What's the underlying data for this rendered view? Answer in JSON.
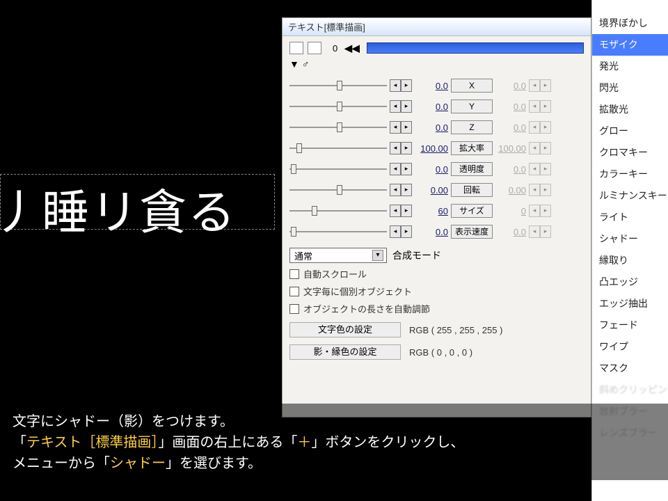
{
  "preview": {
    "text": "丿睡リ貪る"
  },
  "panel": {
    "title": "テキスト[標準描画]",
    "frame": "0",
    "rewind_glyph": "◀◀",
    "tri_glyph": "▼",
    "loop_glyph": "♂",
    "params": [
      {
        "val": "0.0",
        "label": "X",
        "val2": "0.0",
        "thumb": 68
      },
      {
        "val": "0.0",
        "label": "Y",
        "val2": "0.0",
        "thumb": 68
      },
      {
        "val": "0.0",
        "label": "Z",
        "val2": "0.0",
        "thumb": 68
      },
      {
        "val": "100.00",
        "label": "拡大率",
        "val2": "100.00",
        "thumb": 10
      },
      {
        "val": "0.0",
        "label": "透明度",
        "val2": "0.0",
        "thumb": 2
      },
      {
        "val": "0.00",
        "label": "回転",
        "val2": "0.00",
        "thumb": 68
      },
      {
        "val": "60",
        "label": "サイズ",
        "val2": "0",
        "thumb": 32
      },
      {
        "val": "0.0",
        "label": "表示速度",
        "val2": "0.0",
        "thumb": 2
      }
    ],
    "blend_mode_label": "合成モード",
    "blend_mode_value": "通常",
    "checks": [
      "自動スクロール",
      "文字毎に個別オブジェクト",
      "オブジェクトの長さを自動調節"
    ],
    "color_label": "文字色の設定",
    "color_value": "RGB ( 255 , 255 , 255 )",
    "shadow_color_label": "影・縁色の設定",
    "shadow_color_value": "RGB ( 0 , 0 , 0 )"
  },
  "menu": {
    "items": [
      "境界ぼかし",
      "モザイク",
      "発光",
      "閃光",
      "拡散光",
      "グロー",
      "クロマキー",
      "カラーキー",
      "ルミナンスキー",
      "ライト",
      "シャドー",
      "縁取り",
      "凸エッジ",
      "エッジ抽出",
      "フェード",
      "ワイプ",
      "マスク"
    ],
    "highlight_index": 1,
    "dim_items": [
      "斜めクリッピング",
      "放射ブラー",
      "レンズブラー"
    ]
  },
  "instruct": {
    "line1a": "文字にシャドー（影）をつけます。",
    "line2a": "「",
    "line2b": "テキスト［標準描画］",
    "line2c": "」画面の右上にある「",
    "line2d": "＋",
    "line2e": "」ボタンをクリックし、",
    "line3a": "メニューから「",
    "line3b": "シャドー",
    "line3c": "」を選びます。"
  }
}
